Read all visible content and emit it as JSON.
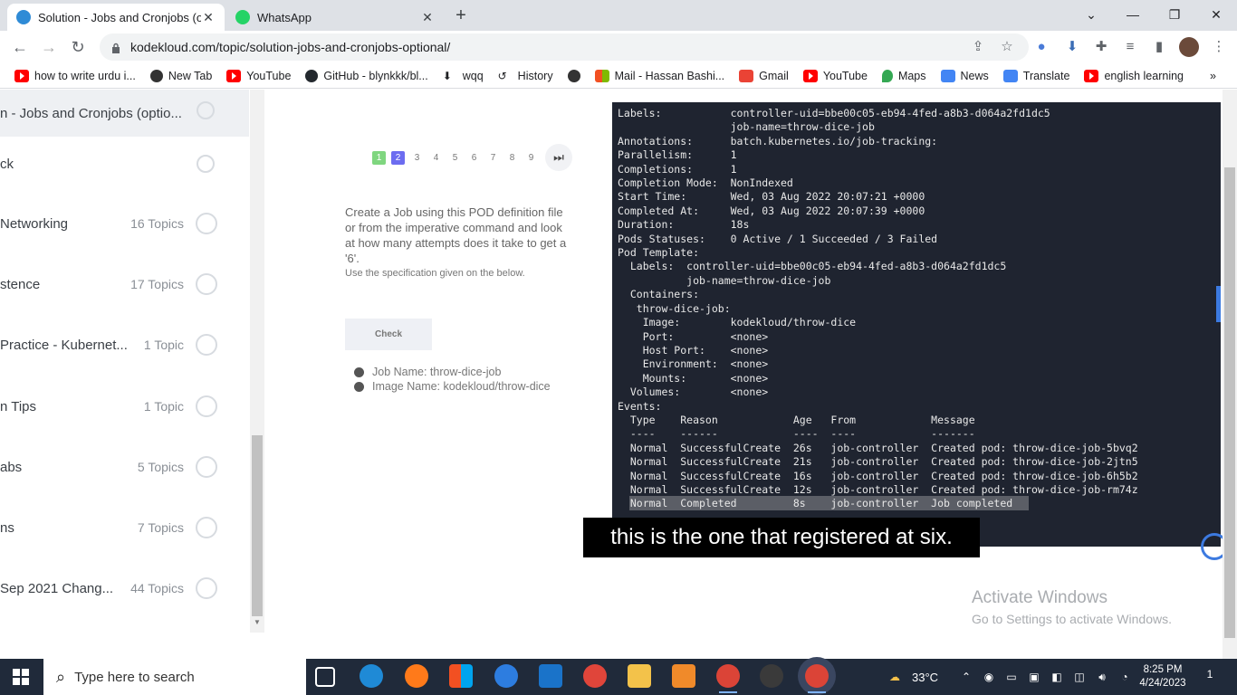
{
  "browser": {
    "tabs": [
      {
        "title": "Solution - Jobs and Cronjobs (op",
        "active": true
      },
      {
        "title": "WhatsApp",
        "active": false
      }
    ],
    "new_tab_symbol": "+",
    "url": "kodekloud.com/topic/solution-jobs-and-cronjobs-optional/",
    "bookmarks": [
      "how to write urdu i...",
      "New Tab",
      "YouTube",
      "GitHub - blynkkk/bl...",
      "wqq",
      "History",
      "",
      "Mail - Hassan Bashi...",
      "Gmail",
      "YouTube",
      "Maps",
      "News",
      "Translate",
      "english learning"
    ],
    "bookmarks_overflow": "»"
  },
  "sidebar": {
    "items": [
      {
        "label": "n - Jobs and Cronjobs (optio...",
        "count": ""
      },
      {
        "label": "ck",
        "count": ""
      },
      {
        "label": "Networking",
        "count": "16 Topics"
      },
      {
        "label": "stence",
        "count": "17 Topics"
      },
      {
        "label": "Practice - Kubernet...",
        "count": "1 Topic"
      },
      {
        "label": "n Tips",
        "count": "1 Topic"
      },
      {
        "label": "abs",
        "count": "5 Topics"
      },
      {
        "label": "ns",
        "count": "7 Topics"
      },
      {
        "label": "Sep 2021 Chang...",
        "count": "44 Topics"
      }
    ]
  },
  "lesson": {
    "pages": [
      "1",
      "2",
      "3",
      "4",
      "5",
      "6",
      "7",
      "8",
      "9"
    ],
    "current_page": "2",
    "task": "Create a Job using this POD definition file or from the imperative command and look at how many attempts does it take to get a '6'.",
    "note": "Use the specification given on the below.",
    "check_label": "Check",
    "requirements": [
      "Job Name: throw-dice-job",
      "Image Name: kodekloud/throw-dice"
    ]
  },
  "terminal": {
    "lines": [
      "Labels:           controller-uid=bbe00c05-eb94-4fed-a8b3-d064a2fd1dc5",
      "                  job-name=throw-dice-job",
      "Annotations:      batch.kubernetes.io/job-tracking:",
      "Parallelism:      1",
      "Completions:      1",
      "Completion Mode:  NonIndexed",
      "Start Time:       Wed, 03 Aug 2022 20:07:21 +0000",
      "Completed At:     Wed, 03 Aug 2022 20:07:39 +0000",
      "Duration:         18s",
      "Pods Statuses:    0 Active / 1 Succeeded / 3 Failed",
      "Pod Template:",
      "  Labels:  controller-uid=bbe00c05-eb94-4fed-a8b3-d064a2fd1dc5",
      "           job-name=throw-dice-job",
      "  Containers:",
      "   throw-dice-job:",
      "    Image:        kodekloud/throw-dice",
      "    Port:         <none>",
      "    Host Port:    <none>",
      "    Environment:  <none>",
      "    Mounts:       <none>",
      "  Volumes:        <none>",
      "Events:",
      "  Type    Reason            Age   From            Message",
      "  ----    ------            ----  ----            -------",
      "  Normal  SuccessfulCreate  26s   job-controller  Created pod: throw-dice-job-5bvq2",
      "  Normal  SuccessfulCreate  21s   job-controller  Created pod: throw-dice-job-2jtn5",
      "  Normal  SuccessfulCreate  16s   job-controller  Created pod: throw-dice-job-6h5b2",
      "  Normal  SuccessfulCreate  12s   job-controller  Created pod: throw-dice-job-rm74z",
      "  Normal  Completed         8s    job-controller  Job completed"
    ]
  },
  "subtitle": "this is the one that registered at six.",
  "watermark": {
    "line1": "Activate Windows",
    "line2": "Go to Settings to activate Windows."
  },
  "taskbar": {
    "search_placeholder": "Type here to search",
    "temperature": "33°C",
    "time": "8:25 PM",
    "date": "4/24/2023",
    "notification_count": "1"
  },
  "colors": {
    "accent": "#6c6cf0",
    "done": "#7fd67f",
    "terminal_bg": "#1f2430",
    "taskbar": "#202a3a"
  }
}
